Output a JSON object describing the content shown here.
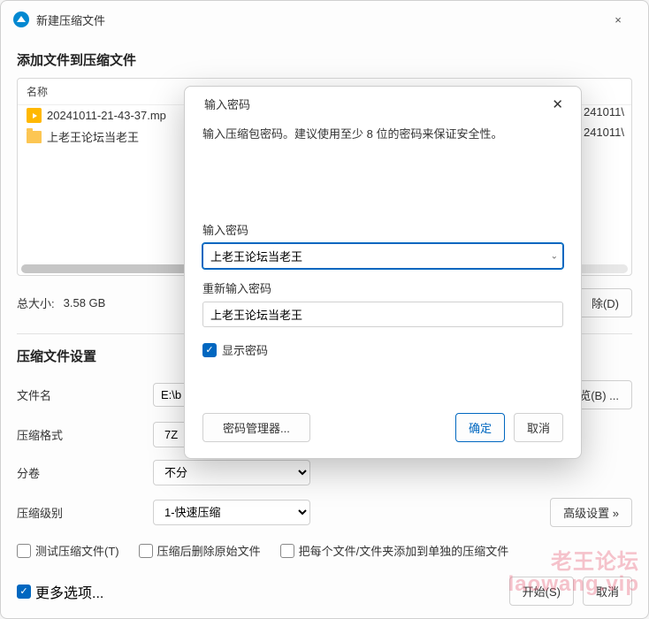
{
  "window": {
    "title": "新建压缩文件",
    "close": "×"
  },
  "main_label": "添加文件到压缩文件",
  "file_table": {
    "header_name": "名称",
    "rows": [
      {
        "name": "20241011-21-43-37.mp",
        "path": "241011\\"
      },
      {
        "name": "上老王论坛当老王",
        "path": "241011\\"
      }
    ]
  },
  "total": {
    "label": "总大小:",
    "value": "3.58 GB",
    "remove_btn": "除(D)"
  },
  "settings_label": "压缩文件设置",
  "form": {
    "filename_label": "文件名",
    "filename_value": "E:\\b",
    "browse_btn": "览(B) ...",
    "format_label": "压缩格式",
    "format_value": "7Z",
    "split_label": "分卷",
    "split_value": "不分",
    "level_label": "压缩级别",
    "level_value": "1-快速压缩",
    "advanced_btn": "高级设置 »"
  },
  "checks": {
    "test": "测试压缩文件(T)",
    "delete_orig": "压缩后删除原始文件",
    "separate": "把每个文件/文件夹添加到单独的压缩文件"
  },
  "footer": {
    "more": "更多选项...",
    "start": "开始(S)",
    "cancel": "取消"
  },
  "modal": {
    "title": "输入密码",
    "hint": "输入压缩包密码。建议使用至少 8 位的密码来保证安全性。",
    "pw_label": "输入密码",
    "pw_value": "上老王论坛当老王",
    "pw2_label": "重新输入密码",
    "pw2_value": "上老王论坛当老王",
    "show_pw": "显示密码",
    "manager": "密码管理器...",
    "ok": "确定",
    "cancel": "取消"
  },
  "watermark": {
    "l1": "老王论坛",
    "l2": "laowang.vip"
  }
}
